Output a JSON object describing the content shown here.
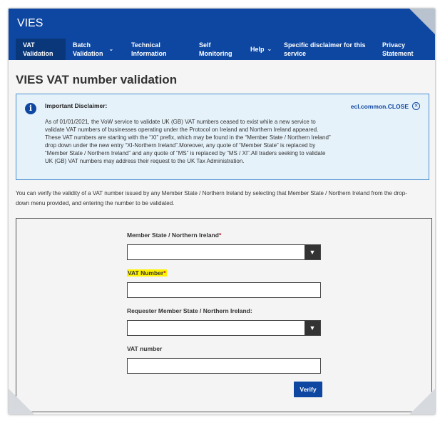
{
  "brand": {
    "title": "VIES"
  },
  "nav": [
    {
      "label": "VAT Validation",
      "line1": "VAT",
      "line2": "Validation",
      "active": true
    },
    {
      "label": "Batch Validation",
      "line1": "Batch",
      "line2": "Validation",
      "dropdown": true
    },
    {
      "label": "Technical Information",
      "line1": "Technical",
      "line2": "Information"
    },
    {
      "label": "Self Monitoring",
      "line1": "Self",
      "line2": "Monitoring"
    },
    {
      "label": "Help",
      "line1": "Help",
      "line2": "",
      "dropdown": true
    },
    {
      "label": "Specific disclaimer for this service",
      "line1": "Specific disclaimer for this",
      "line2": "service"
    },
    {
      "label": "Privacy Statement",
      "line1": "Privacy",
      "line2": "Statement"
    }
  ],
  "page": {
    "title": "VIES VAT number validation"
  },
  "disclaimer": {
    "title": "Important Disclaimer:",
    "close_label": "ecl.common.CLOSE",
    "lines": [
      "As of 01/01/2021, the VoW service to validate UK (GB) VAT numbers ceased to exist while a new service to",
      "validate VAT numbers of businesses operating under the Protocol on Ireland and Northern Ireland appeared.",
      "These VAT numbers are starting with the “XI” prefix, which may be found in the “Member State / Northern Ireland”",
      "drop down under the new entry “XI-Northern Ireland”.Moreover, any quote of “Member State” is replaced by",
      "“Member State / Northern Ireland” and any quote of “MS” is replaced by “MS / XI”.All traders seeking to validate",
      "UK (GB) VAT numbers may address their request to the UK Tax Administration."
    ]
  },
  "intro": {
    "line1": "You can verify the validity of a VAT number issued by any Member State / Northern Ireland by selecting that Member State / Northern Ireland from the drop-",
    "line2": "down menu provided, and entering the number to be validated."
  },
  "form": {
    "member_state_label": "Member State / Northern Ireland",
    "member_state_value": "",
    "vat_number_label": "VAT Number",
    "vat_number_value": "",
    "requester_label": "Requester Member State / Northern Ireland:",
    "requester_value": "",
    "requester_vat_label": "VAT number",
    "requester_vat_value": "",
    "required_mark": "*",
    "verify_label": "Verify"
  },
  "colors": {
    "brand_blue": "#0e47a1",
    "required_red": "#c4121a",
    "highlight": "#fff200"
  }
}
